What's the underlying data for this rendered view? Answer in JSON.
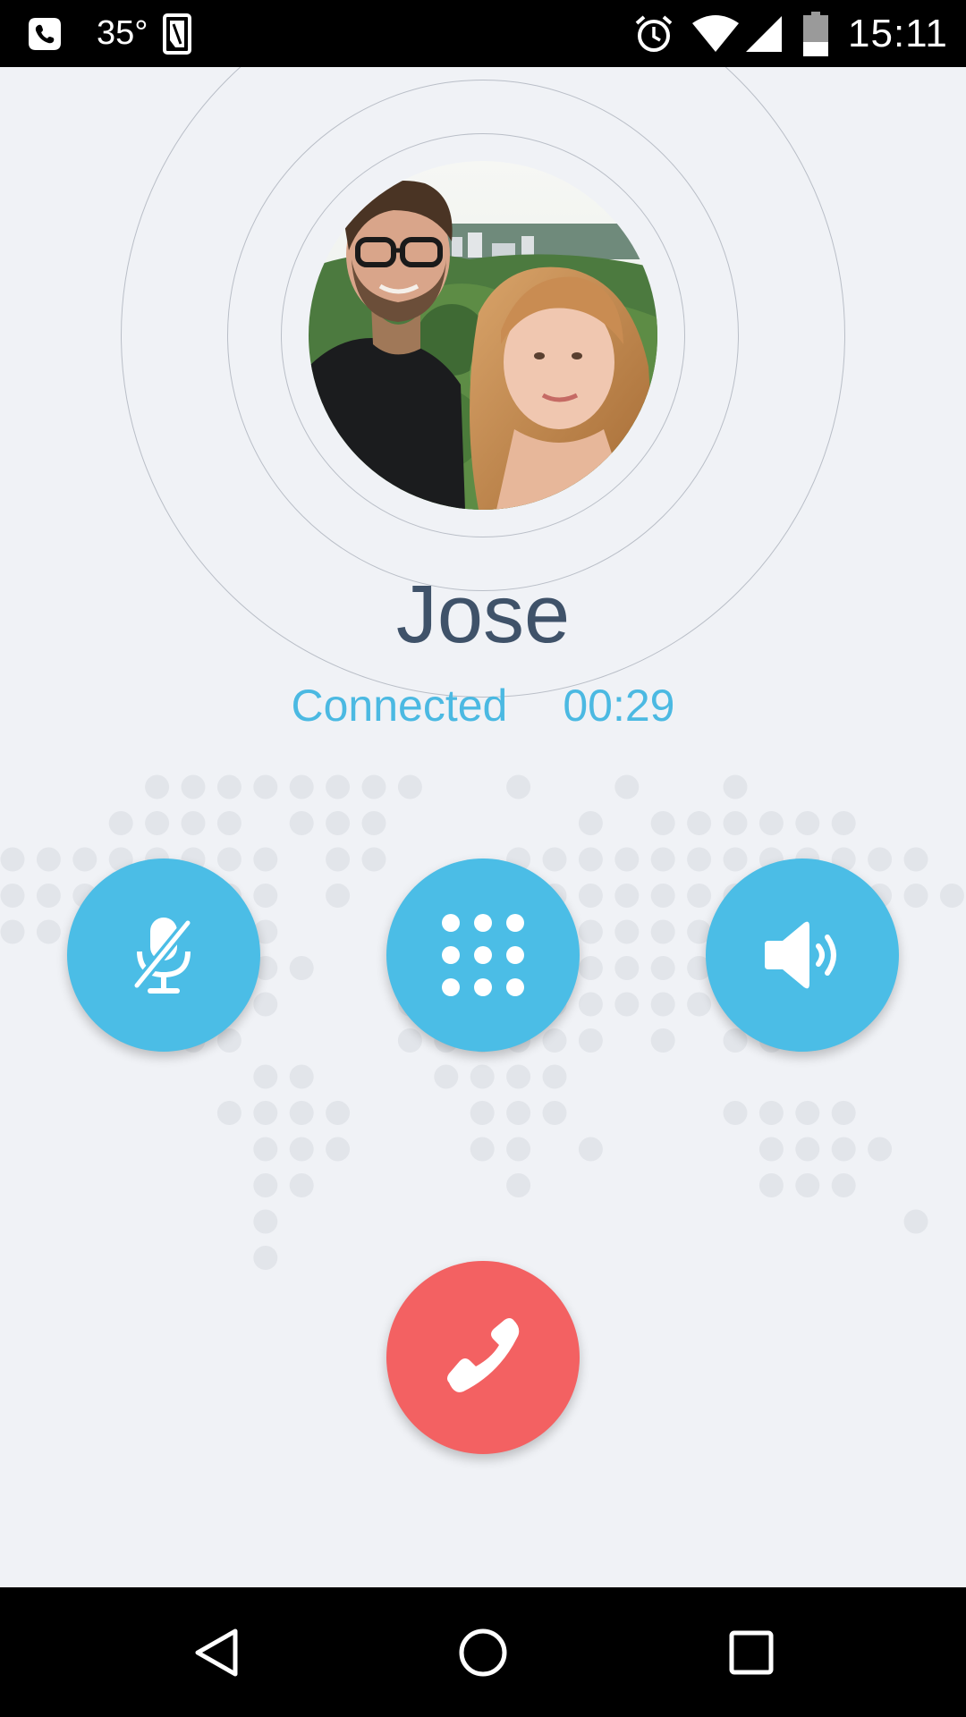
{
  "status_bar": {
    "temperature": "35°",
    "clock": "15:11",
    "icons": [
      "app-notification-icon",
      "temperature-indicator",
      "sim-card-icon",
      "alarm-clock-icon",
      "wifi-icon",
      "cell-signal-icon",
      "battery-icon"
    ]
  },
  "call": {
    "caller_name": "Jose",
    "status_label": "Connected",
    "duration": "00:29"
  },
  "controls": {
    "mute_icon": "microphone-muted-icon",
    "dialpad_icon": "dialpad-icon",
    "speaker_icon": "speaker-icon",
    "end_call_icon": "end-call-phone-icon"
  },
  "navigation": {
    "icons": [
      "back-icon",
      "home-icon",
      "recents-icon"
    ]
  },
  "colors": {
    "accent_blue": "#4bbde6",
    "end_call_red": "#f36162",
    "name_text": "#3f5269",
    "status_text": "#4bb9e2",
    "background": "#f0f2f6"
  }
}
